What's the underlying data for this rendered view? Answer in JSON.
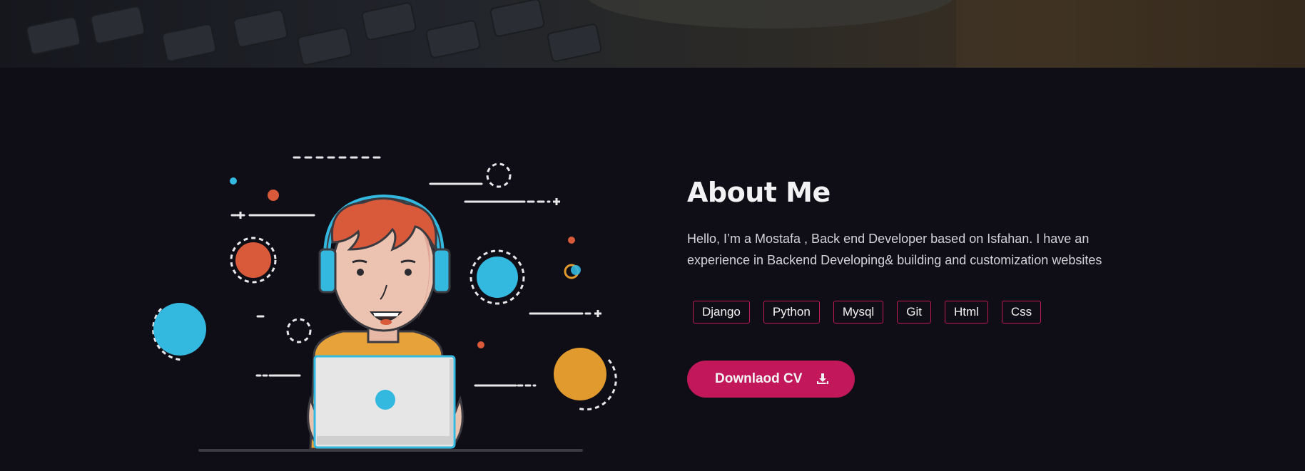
{
  "about": {
    "title": "About Me",
    "description_line1": "Hello, I’m a Mostafa , Back end Developer based on Isfahan. I have an",
    "description_line2": "experience in Backend Developing& building and customization websites",
    "skills": [
      "Django",
      "Python",
      "Mysql",
      "Git",
      "Html",
      "Css"
    ],
    "cv_button_label": "Downlaod CV",
    "cv_button_icon": "download-icon"
  },
  "colors": {
    "accent": "#c2185b",
    "background": "#0f0e16",
    "illustration_blue": "#33b8e0",
    "illustration_red": "#d95a3a",
    "illustration_orange": "#e09a2e"
  }
}
